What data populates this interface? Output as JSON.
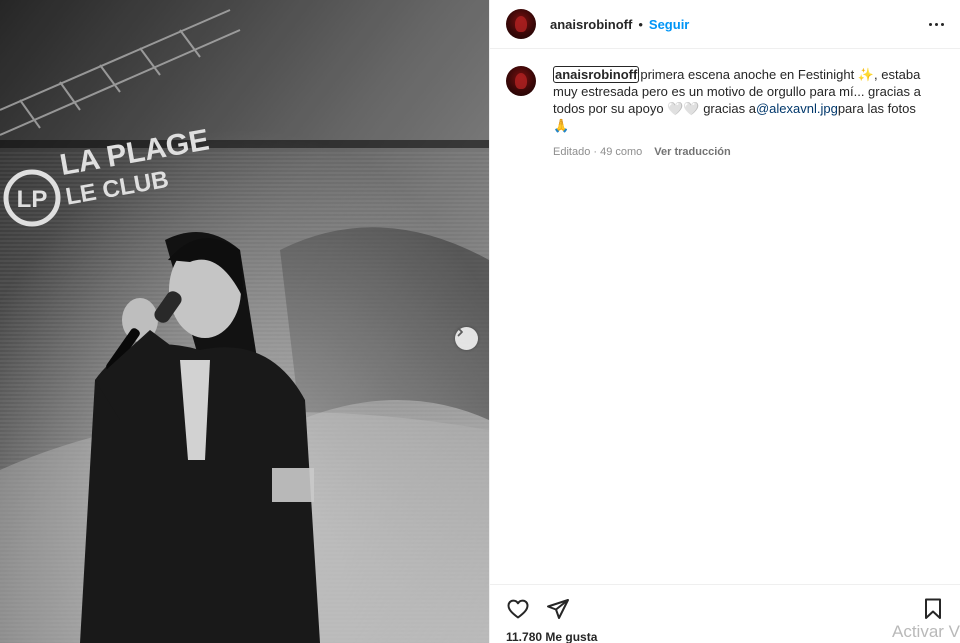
{
  "photo": {
    "alt": "",
    "venue_sign_line1": "LA PLAGE",
    "venue_sign_line2": "LE CLUB",
    "logo_letters": "LP"
  },
  "header": {
    "username": "anaisrobinoff",
    "separator": "•",
    "follow_label": "Seguir",
    "more_icon": "more-horizontal-icon"
  },
  "caption": {
    "username": "anaisrobinoff",
    "text_part1": "primera escena anoche en Festinight ✨, estaba muy estresada pero es un motivo de orgullo para mí... gracias a todos por su apoyo ",
    "hearts": "🤍🤍",
    "text_part2": " gracias a",
    "mention": "@alexavnl.jpg",
    "text_part3": "para las fotos 🙏"
  },
  "meta": {
    "edited": "Editado · 49 como",
    "translate": "Ver traducción"
  },
  "actions": {
    "like_icon": "heart-icon",
    "share_icon": "send-icon",
    "save_icon": "bookmark-icon",
    "likes_text": "11.780 Me gusta"
  },
  "overlay": {
    "activation_watermark": "Activar V"
  },
  "colors": {
    "follow_blue": "#0095f6",
    "mention_blue": "#00376b",
    "text_dark": "#262626",
    "meta_gray": "#8e8e8e",
    "avatar_red": "#7a1010"
  }
}
